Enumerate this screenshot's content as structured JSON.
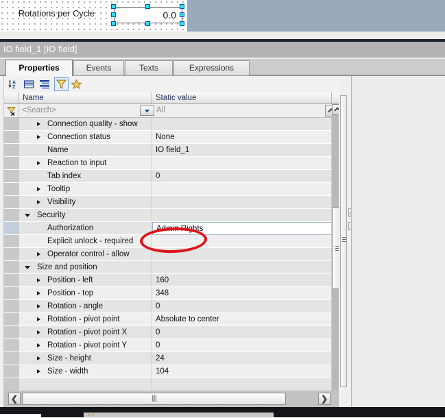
{
  "canvas": {
    "field_label": "Rotations per Cycle",
    "io_field_value": "0.0",
    "selection_handles": 8
  },
  "inspector": {
    "title": "IO field_1 [IO field]",
    "tabs": [
      {
        "label": "Properties",
        "active": true
      },
      {
        "label": "Events",
        "active": false
      },
      {
        "label": "Texts",
        "active": false
      },
      {
        "label": "Expressions",
        "active": false
      }
    ],
    "toolbar_icons": [
      "sort-az-icon",
      "group-folder-icon",
      "list-view-icon",
      "filter-funnel-icon",
      "favorites-star-icon"
    ],
    "grid": {
      "columns": [
        "Name",
        "Static value"
      ],
      "filter_row": {
        "search_placeholder": "<Search>",
        "value_filter": "All"
      },
      "rows": [
        {
          "name": "Connection quality - show",
          "value": "",
          "indent": 1,
          "expandable": true,
          "expanded": false,
          "group": false,
          "selected": false
        },
        {
          "name": "Connection status",
          "value": "None",
          "indent": 1,
          "expandable": true,
          "expanded": false,
          "group": false,
          "selected": false
        },
        {
          "name": "Name",
          "value": "IO field_1",
          "indent": 1,
          "expandable": false,
          "expanded": false,
          "group": false,
          "selected": false
        },
        {
          "name": "Reaction to input",
          "value": "",
          "indent": 1,
          "expandable": true,
          "expanded": false,
          "group": false,
          "selected": false
        },
        {
          "name": "Tab index",
          "value": "0",
          "indent": 1,
          "expandable": false,
          "expanded": false,
          "group": false,
          "selected": false
        },
        {
          "name": "Tooltip",
          "value": "",
          "indent": 1,
          "expandable": true,
          "expanded": false,
          "group": false,
          "selected": false
        },
        {
          "name": "Visibility",
          "value": "",
          "indent": 1,
          "expandable": true,
          "expanded": false,
          "group": false,
          "selected": false
        },
        {
          "name": "Security",
          "value": "",
          "indent": 0,
          "expandable": true,
          "expanded": true,
          "group": true,
          "selected": false
        },
        {
          "name": "Authorization",
          "value": "Admin Rights",
          "indent": 1,
          "expandable": false,
          "expanded": false,
          "group": false,
          "selected": true,
          "editing": true
        },
        {
          "name": "Explicit unlock - required",
          "value": "",
          "indent": 1,
          "expandable": false,
          "expanded": false,
          "group": false,
          "selected": false
        },
        {
          "name": "Operator control - allow",
          "value": "",
          "indent": 1,
          "expandable": true,
          "expanded": false,
          "group": false,
          "selected": false
        },
        {
          "name": "Size and position",
          "value": "",
          "indent": 0,
          "expandable": true,
          "expanded": true,
          "group": true,
          "selected": false
        },
        {
          "name": "Position - left",
          "value": "160",
          "indent": 1,
          "expandable": true,
          "expanded": false,
          "group": false,
          "selected": false
        },
        {
          "name": "Position - top",
          "value": "348",
          "indent": 1,
          "expandable": true,
          "expanded": false,
          "group": false,
          "selected": false
        },
        {
          "name": "Rotation - angle",
          "value": "0",
          "indent": 1,
          "expandable": true,
          "expanded": false,
          "group": false,
          "selected": false
        },
        {
          "name": "Rotation - pivot point",
          "value": "Absolute to center",
          "indent": 1,
          "expandable": true,
          "expanded": false,
          "group": false,
          "selected": false
        },
        {
          "name": "Rotation - pivot point X",
          "value": "0",
          "indent": 1,
          "expandable": true,
          "expanded": false,
          "group": false,
          "selected": false
        },
        {
          "name": "Rotation - pivot point Y",
          "value": "0",
          "indent": 1,
          "expandable": true,
          "expanded": false,
          "group": false,
          "selected": false
        },
        {
          "name": "Size - height",
          "value": "24",
          "indent": 1,
          "expandable": true,
          "expanded": false,
          "group": false,
          "selected": false
        },
        {
          "name": "Size - width",
          "value": "104",
          "indent": 1,
          "expandable": true,
          "expanded": false,
          "group": false,
          "selected": false
        },
        {
          "name": "",
          "value": "",
          "indent": 1,
          "expandable": false,
          "expanded": false,
          "group": false,
          "selected": false
        }
      ]
    },
    "scrollbars": {
      "vertical_up": "▲",
      "vertical_down": "▼",
      "horizontal_left": "❮",
      "horizontal_right": "❯",
      "horizontal_grip": "||||"
    }
  },
  "annotation": {
    "shape": "red-ellipse",
    "color": "#e1121a",
    "targets": "Admin Rights"
  },
  "colors": {
    "canvas_backdrop": "#98aabb",
    "inspector_title_bar": "#b3b3b3",
    "grid_row_alt": "#e4e4e4",
    "grid_row_norm": "#efefef",
    "gutter": "#c9c9c9",
    "selected_gutter": "#c3cfdd",
    "handle_fill": "#29e2f7",
    "handle_border": "#0b4fa8",
    "annotation_red": "#e1121a"
  }
}
